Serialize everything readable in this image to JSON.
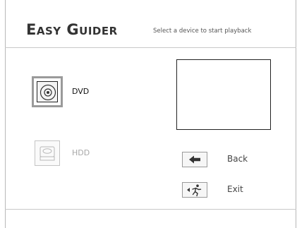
{
  "header": {
    "brand": "Easy Guider",
    "subtitle": "Select a device to start playback"
  },
  "devices": [
    {
      "label": "DVD",
      "icon": "dvd-disc-icon",
      "selected": true,
      "enabled": true
    },
    {
      "label": "HDD",
      "icon": "hard-disk-icon",
      "selected": false,
      "enabled": false
    }
  ],
  "actions": {
    "back": {
      "label": "Back",
      "icon": "left-arrow-icon"
    },
    "exit": {
      "label": "Exit",
      "icon": "exit-runner-icon"
    }
  },
  "colors": {
    "text": "#333333",
    "disabled_text": "#a8a8a8",
    "selection_border": "#9a9a9a",
    "frame": "#b8b8b8"
  }
}
